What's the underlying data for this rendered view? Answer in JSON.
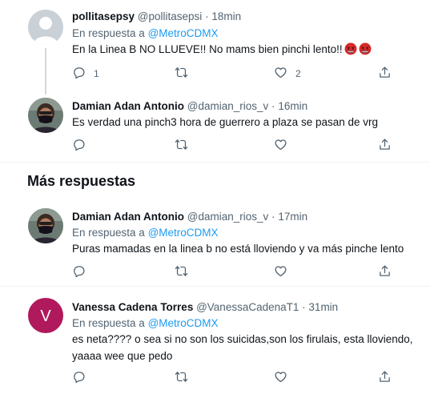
{
  "tweets": [
    {
      "name": "pollitasepsy",
      "handle": "@pollitasepsi",
      "time": "18min",
      "reply_prefix": "En respuesta a",
      "reply_to": "@MetroCDMX",
      "text": "En la Linea B NO LLUEVE!! No mams bien pinchi lento!!",
      "emoji": [
        "angry-face",
        "angry-face"
      ],
      "reply_count": "1",
      "retweet_count": "",
      "like_count": "2"
    },
    {
      "name": "Damian Adan Antonio",
      "handle": "@damian_rios_v",
      "time": "16min",
      "text": "Es verdad una pinch3 hora  de guerrero a plaza se pasan de vrg"
    }
  ],
  "section": {
    "title": "Más respuestas"
  },
  "more_replies": [
    {
      "name": "Damian Adan Antonio",
      "handle": "@damian_rios_v",
      "time": "17min",
      "reply_prefix": "En respuesta a",
      "reply_to": "@MetroCDMX",
      "text": "Puras mamadas en la linea b no está lloviendo y va más pinche lento"
    },
    {
      "name": "Vanessa Cadena Torres",
      "handle": "@VanessaCadenaT1",
      "time": "31min",
      "reply_prefix": "En respuesta a",
      "reply_to": "@MetroCDMX",
      "avatar_letter": "V",
      "avatar_color": "#b0195b",
      "text_line1": "es neta???? o sea si no son los suicidas,son los firulais, esta lloviendo,",
      "text_line2": "yaaaa wee que pedo"
    }
  ],
  "separator": "·",
  "icons": [
    "reply-icon",
    "retweet-icon",
    "like-icon",
    "share-icon"
  ]
}
